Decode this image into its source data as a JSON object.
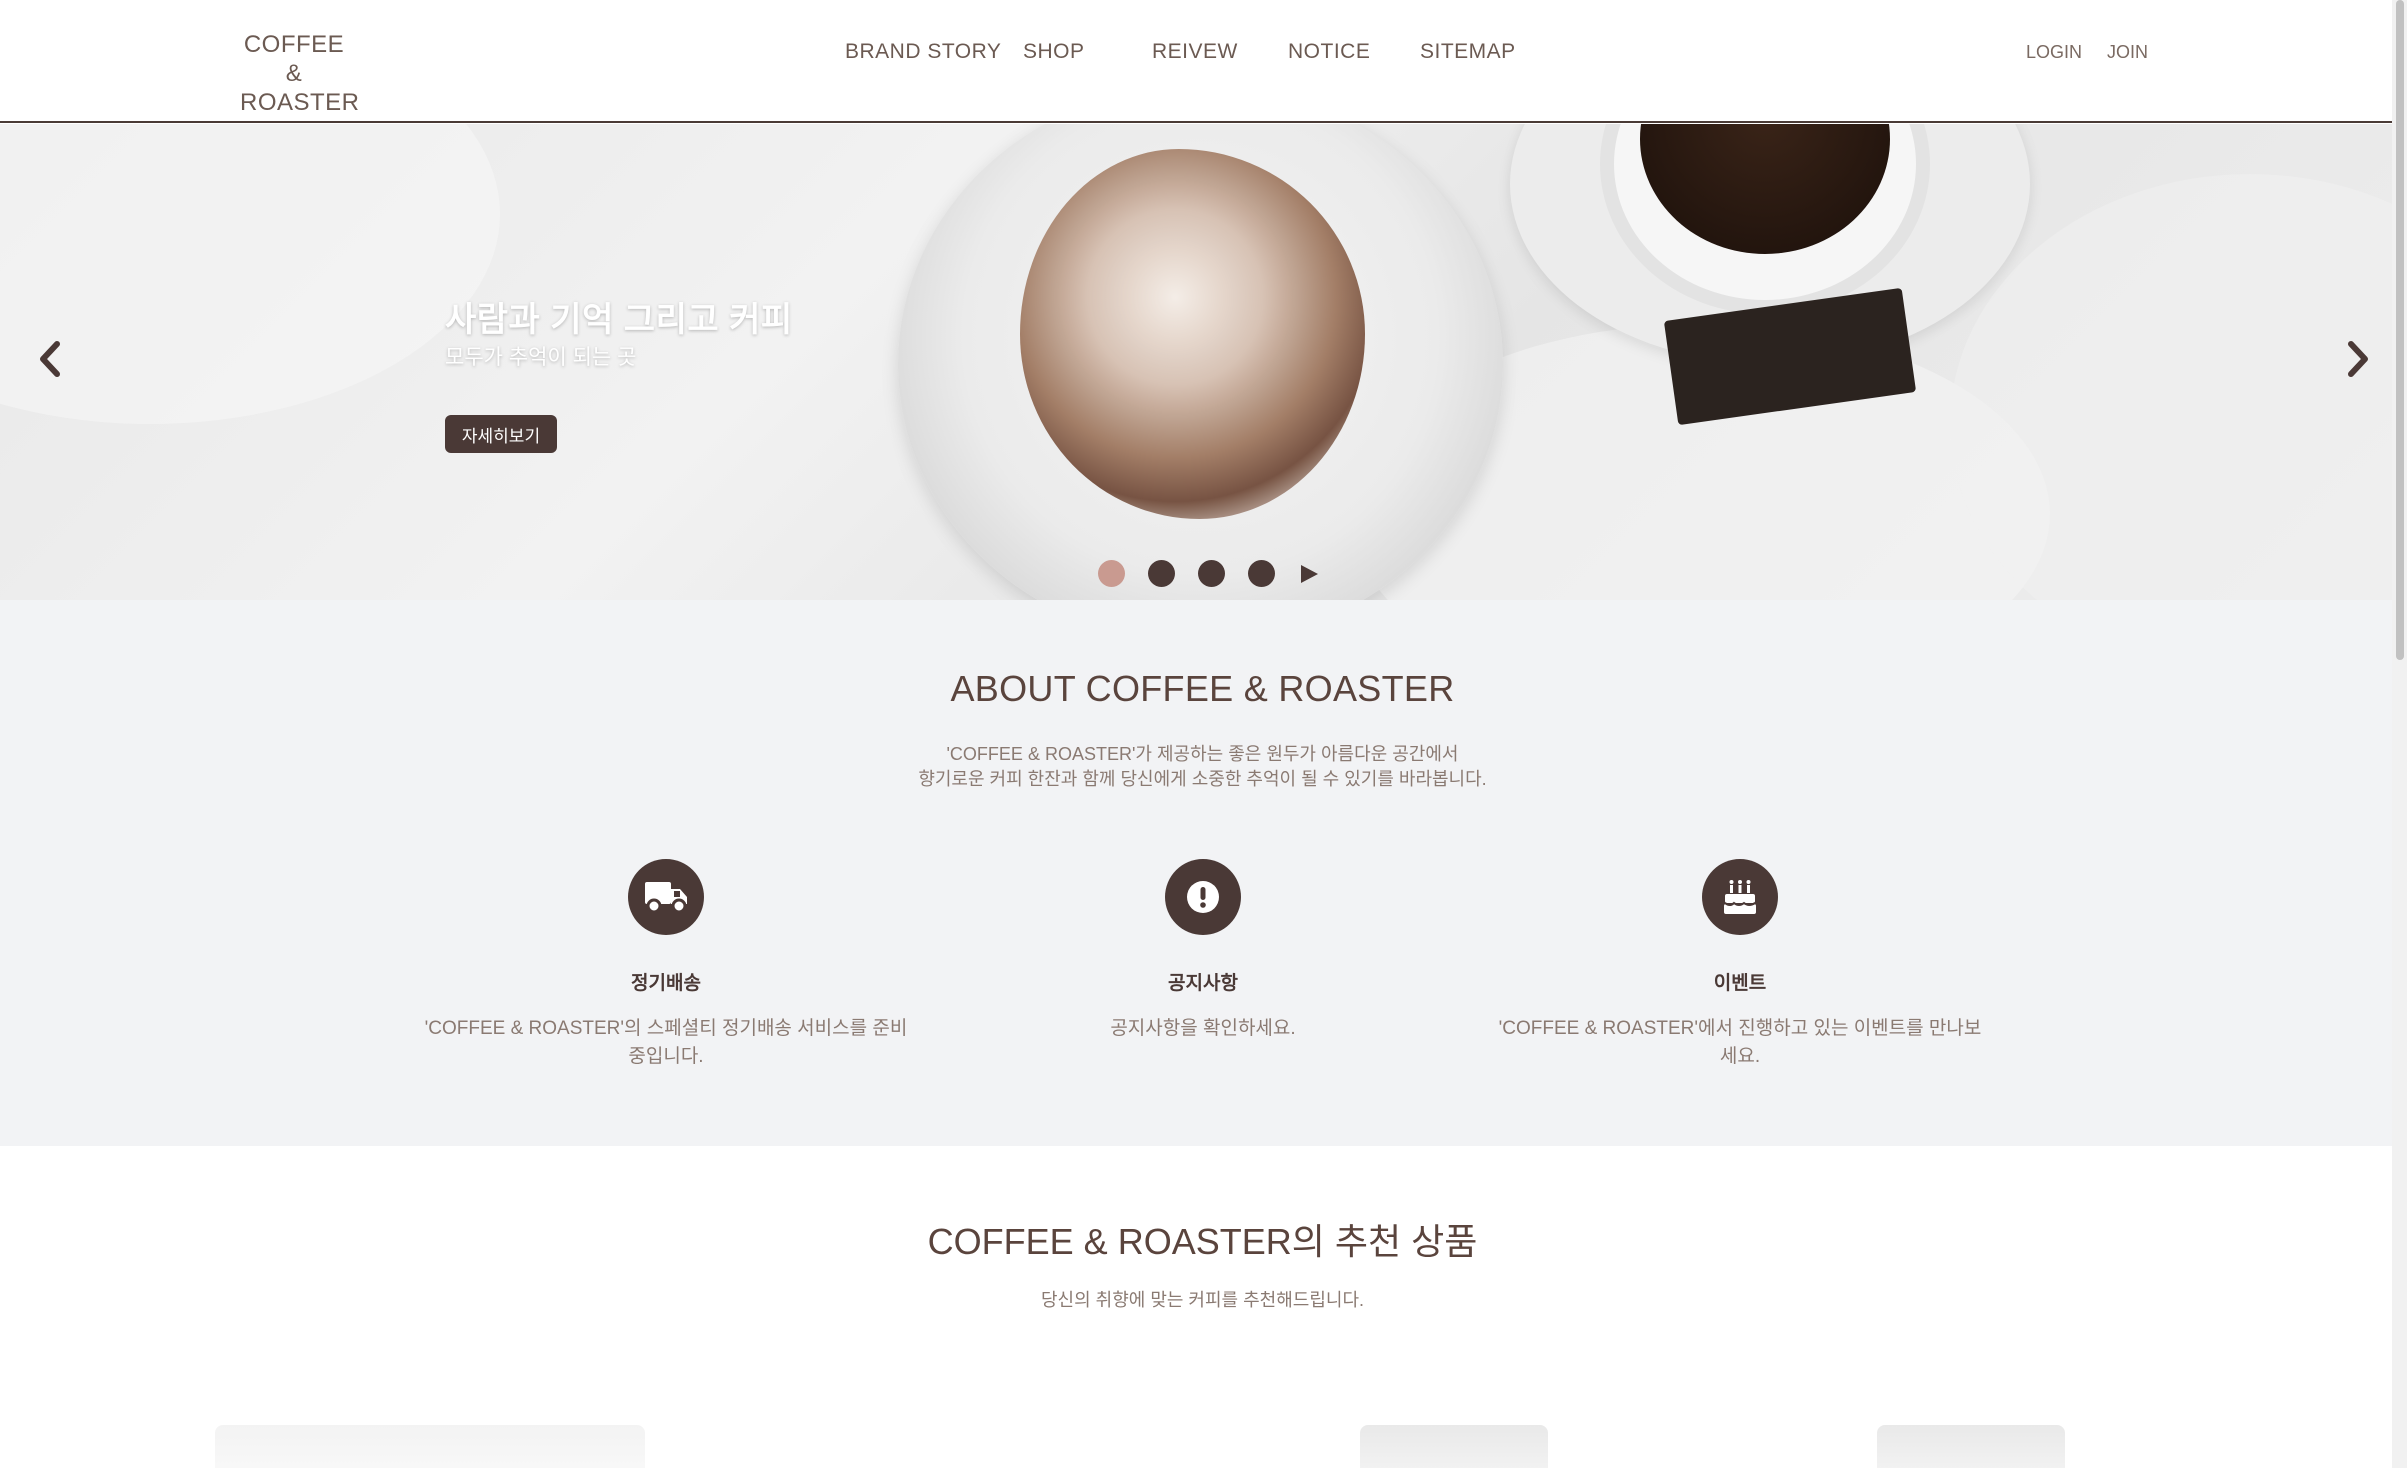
{
  "header": {
    "logo_line1": "COFFEE &",
    "logo_line2": "ROASTER",
    "nav": [
      "BRAND STORY",
      "SHOP",
      "REIVEW",
      "NOTICE",
      "SITEMAP"
    ],
    "auth": [
      "LOGIN",
      "JOIN"
    ]
  },
  "hero": {
    "title": "사람과 기억 그리고 커피",
    "subtitle": "모두가 추억이 되는 곳",
    "button": "자세히보기",
    "slide_count": 4,
    "active_slide": 1
  },
  "about": {
    "title": "ABOUT COFFEE & ROASTER",
    "desc_line1": "'COFFEE & ROASTER'가 제공하는 좋은 원두가 아름다운 공간에서",
    "desc_line2": "향기로운 커피 한잔과 함께 당신에게 소중한 추억이 될 수 있기를 바라봅니다.",
    "features": [
      {
        "icon": "truck-icon",
        "title": "정기배송",
        "desc": "'COFFEE & ROASTER'의 스페셜티 정기배송 서비스를 준비중입니다."
      },
      {
        "icon": "exclamation-icon",
        "title": "공지사항",
        "desc": "공지사항을 확인하세요."
      },
      {
        "icon": "birthday-cake-icon",
        "title": "이벤트",
        "desc": "'COFFEE & ROASTER'에서 진행하고 있는 이벤트를 만나보세요."
      }
    ]
  },
  "recommend": {
    "title": "COFFEE & ROASTER의 추천 상품",
    "desc": "당신의 취향에 맞는 커피를 추천해드립니다."
  },
  "colors": {
    "accent": "#4a3936",
    "active_dot": "#c99a90",
    "section_bg": "#f2f3f5"
  }
}
